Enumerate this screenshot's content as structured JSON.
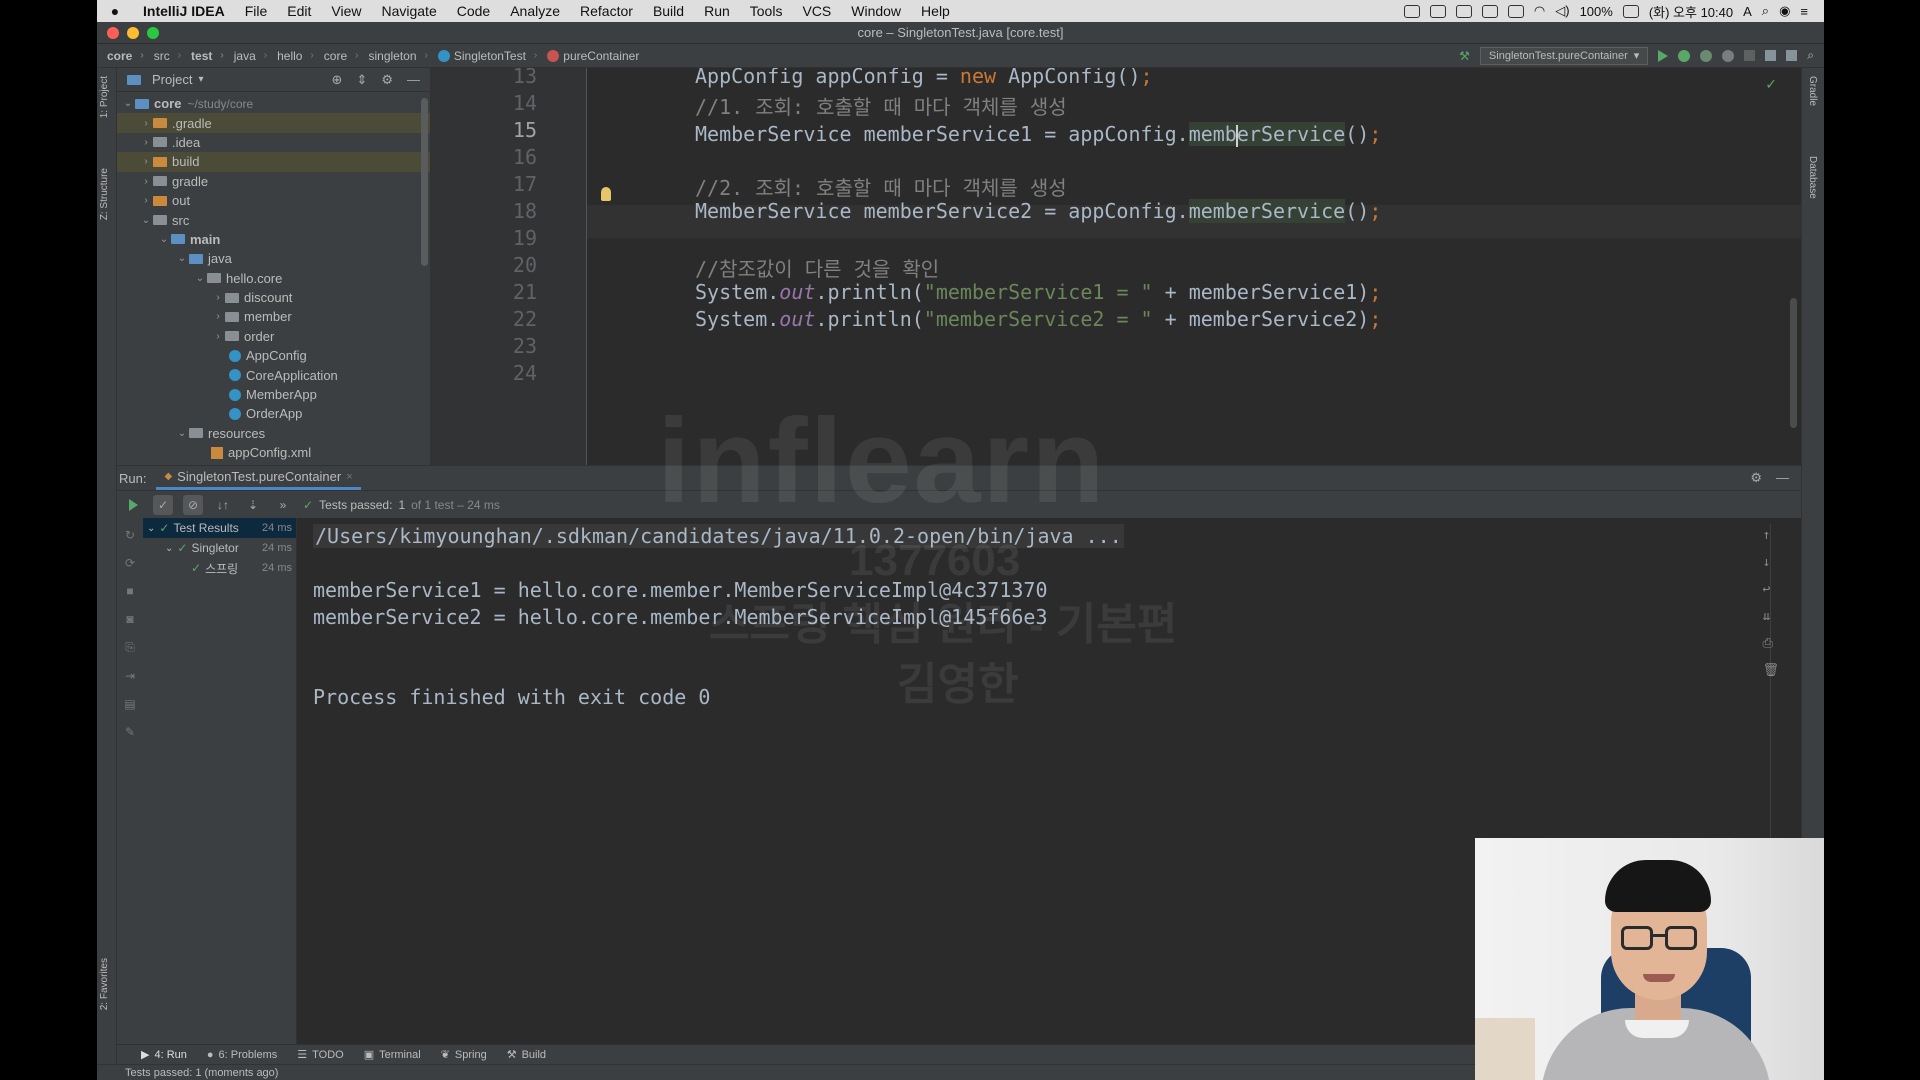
{
  "menubar": {
    "app_name": "IntelliJ IDEA",
    "items": [
      "File",
      "Edit",
      "View",
      "Navigate",
      "Code",
      "Analyze",
      "Refactor",
      "Build",
      "Run",
      "Tools",
      "VCS",
      "Window",
      "Help"
    ],
    "battery": "100%",
    "clock": "(화) 오후 10:40",
    "input_indicator": "A"
  },
  "window": {
    "title": "core – SingletonTest.java [core.test]"
  },
  "breadcrumbs": [
    "core",
    "src",
    "test",
    "java",
    "hello",
    "core",
    "singleton",
    "SingletonTest",
    "pureContainer"
  ],
  "run_config": "SingletonTest.pureContainer",
  "left_stripe": {
    "project_tab": "1: Project",
    "structure_tab": "Z: Structure",
    "favorites_tab": "2: Favorites"
  },
  "right_stripe": {
    "gradle_tab": "Gradle",
    "database_tab": "Database"
  },
  "project": {
    "header": "Project",
    "root_label": "core",
    "root_path": "~/study/core",
    "items": [
      {
        "label": ".gradle",
        "kind": "folder-orange",
        "depth": 1
      },
      {
        "label": ".idea",
        "kind": "folder",
        "depth": 1
      },
      {
        "label": "build",
        "kind": "folder-orange",
        "depth": 1
      },
      {
        "label": "gradle",
        "kind": "folder",
        "depth": 1
      },
      {
        "label": "out",
        "kind": "folder-orange",
        "depth": 1
      },
      {
        "label": "src",
        "kind": "folder",
        "depth": 1
      },
      {
        "label": "main",
        "kind": "folder",
        "depth": 2
      },
      {
        "label": "java",
        "kind": "folder-blue",
        "depth": 3
      },
      {
        "label": "hello.core",
        "kind": "folder",
        "depth": 4
      },
      {
        "label": "discount",
        "kind": "folder",
        "depth": 5
      },
      {
        "label": "member",
        "kind": "folder",
        "depth": 5
      },
      {
        "label": "order",
        "kind": "folder",
        "depth": 5
      },
      {
        "label": "AppConfig",
        "kind": "java",
        "depth": 5
      },
      {
        "label": "CoreApplication",
        "kind": "java",
        "depth": 5
      },
      {
        "label": "MemberApp",
        "kind": "java",
        "depth": 5
      },
      {
        "label": "OrderApp",
        "kind": "java",
        "depth": 5
      },
      {
        "label": "resources",
        "kind": "folder",
        "depth": 3
      },
      {
        "label": "appConfig.xml",
        "kind": "xml",
        "depth": 4
      }
    ]
  },
  "editor": {
    "line_numbers": [
      "13",
      "14",
      "15",
      "16",
      "17",
      "18",
      "19",
      "20",
      "21",
      "22",
      "23",
      "24"
    ],
    "current_line": "15",
    "code": {
      "l13_type": "AppConfig",
      "l13_var": " appConfig = ",
      "l13_new": "new",
      "l13_rest": " AppConfig()",
      "l13_semi": ";",
      "l14_comment": "//1. 조회: 호출할 때 마다 객체를 생성",
      "l15_a": "MemberService memberService1 = appConfig.",
      "l15_m1": "memb",
      "l15_m2": "erService",
      "l15_b": "()",
      "l15_semi": ";",
      "l17_comment": "//2. 조회: 호출할 때 마다 객체를 생성",
      "l18_a": "MemberService memberService2 = appConfig.",
      "l18_m": "memberService",
      "l18_b": "()",
      "l18_semi": ";",
      "l20_comment": "//참조값이 다른 것을 확인",
      "l21_a": "System.",
      "l21_out": "out",
      "l21_b": ".println(",
      "l21_str": "\"memberService1 = \"",
      "l21_c": " + memberService1)",
      "l21_semi": ";",
      "l22_a": "System.",
      "l22_out": "out",
      "l22_b": ".println(",
      "l22_str": "\"memberService2 = \"",
      "l22_c": " + memberService2)",
      "l22_semi": ";"
    }
  },
  "run": {
    "label": "Run:",
    "tab": "SingletonTest.pureContainer",
    "tests_passed_label": "Tests passed:",
    "tests_passed_count": "1",
    "tests_passed_detail": "of 1 test – 24 ms",
    "tree": [
      {
        "label": "Test Results",
        "time": "24 ms"
      },
      {
        "label": "Singletor",
        "time": "24 ms"
      },
      {
        "label": "스프링",
        "time": "24 ms"
      }
    ],
    "console": [
      "/Users/kimyounghan/.sdkman/candidates/java/11.0.2-open/bin/java ...",
      "memberService1 = hello.core.member.MemberServiceImpl@4c371370",
      "memberService2 = hello.core.member.MemberServiceImpl@145f66e3",
      "Process finished with exit code 0"
    ]
  },
  "tool_windows": [
    {
      "label": "4: Run",
      "icon": "play-icon"
    },
    {
      "label": "6: Problems",
      "icon": "info-icon"
    },
    {
      "label": "TODO",
      "icon": "list-icon"
    },
    {
      "label": "Terminal",
      "icon": "terminal-icon"
    },
    {
      "label": "Spring",
      "icon": "leaf-icon"
    },
    {
      "label": "Build",
      "icon": "hammer-icon"
    }
  ],
  "status_bar": {
    "message": "Tests passed: 1 (moments ago)"
  },
  "watermark": {
    "logo_text": "inflearn",
    "number": "1377603",
    "course": "스프링 핵심 원리 - 기본편",
    "author": "김영한"
  },
  "colors": {
    "editor_bg": "#2b2b2b",
    "panel_bg": "#3c3f41",
    "keyword": "#cc7832",
    "string": "#6a8759",
    "comment": "#808080",
    "field": "#9876aa",
    "success": "#59a869"
  }
}
